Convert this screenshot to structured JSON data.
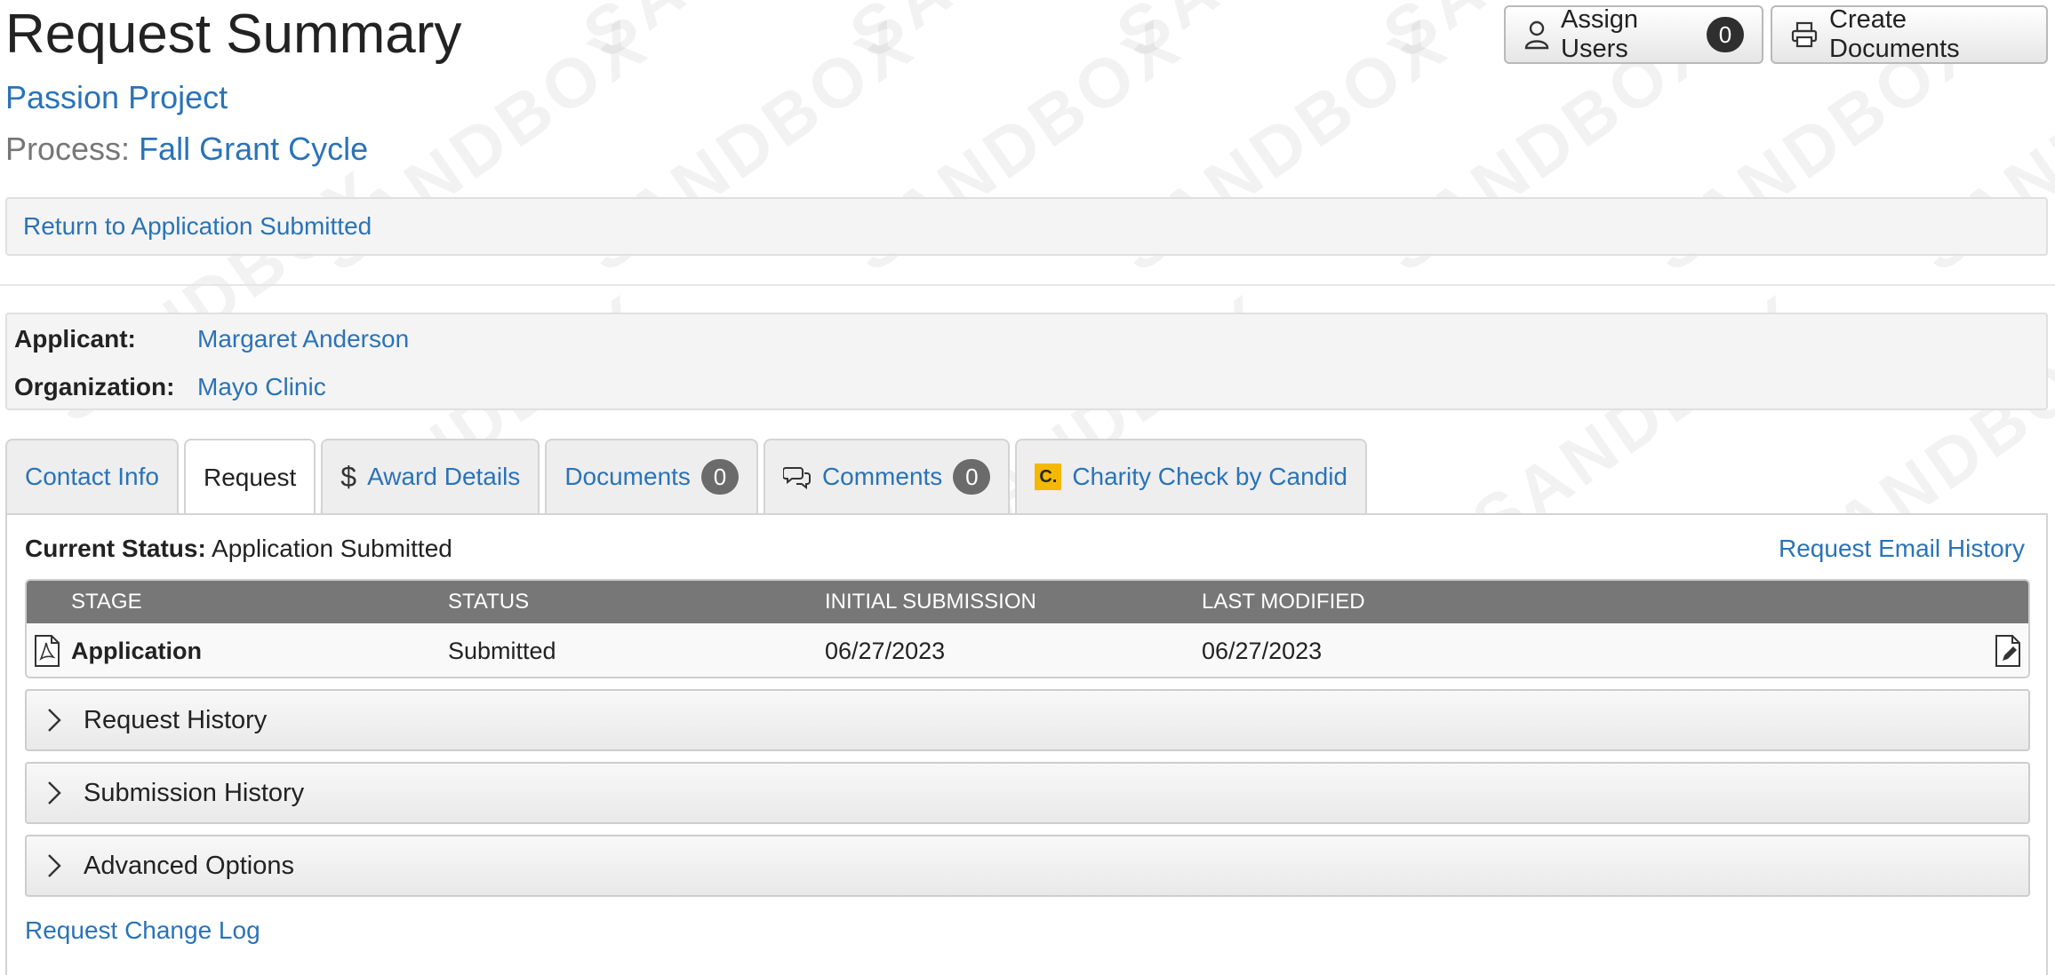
{
  "header": {
    "title": "Request Summary",
    "project": "Passion Project",
    "process_label": "Process:",
    "process_name": "Fall Grant Cycle"
  },
  "watermark": "SANDBOX",
  "actions": {
    "assign_users_label": "Assign Users",
    "assign_users_count": "0",
    "create_documents_label": "Create Documents"
  },
  "return_link": "Return to Application Submitted",
  "applicant": {
    "applicant_label": "Applicant:",
    "applicant_name": "Margaret Anderson",
    "organization_label": "Organization:",
    "organization_name": "Mayo Clinic"
  },
  "tabs": [
    {
      "label": "Contact Info",
      "icon": null,
      "active": false
    },
    {
      "label": "Request",
      "icon": null,
      "active": true
    },
    {
      "label": "Award Details",
      "icon": "dollar-icon",
      "active": false
    },
    {
      "label": "Documents",
      "icon": null,
      "badge": "0",
      "active": false
    },
    {
      "label": "Comments",
      "icon": "comments-icon",
      "badge": "0",
      "active": false
    },
    {
      "label": "Charity Check by Candid",
      "icon": "candid-logo-icon",
      "active": false
    }
  ],
  "status": {
    "label": "Current Status:",
    "value": "Application Submitted",
    "email_history_link": "Request Email History"
  },
  "stage_table": {
    "columns": [
      "Stage",
      "Status",
      "Initial Submission",
      "Last Modified"
    ],
    "rows": [
      {
        "stage": "Application",
        "status": "Submitted",
        "initial_submission": "06/27/2023",
        "last_modified": "06/27/2023"
      }
    ]
  },
  "accordions": [
    {
      "label": "Request History"
    },
    {
      "label": "Submission History"
    },
    {
      "label": "Advanced Options"
    }
  ],
  "change_log_link": "Request Change Log",
  "colors": {
    "link": "#2a73b8",
    "table_header": "#777777",
    "candid_badge": "#f5b800"
  }
}
